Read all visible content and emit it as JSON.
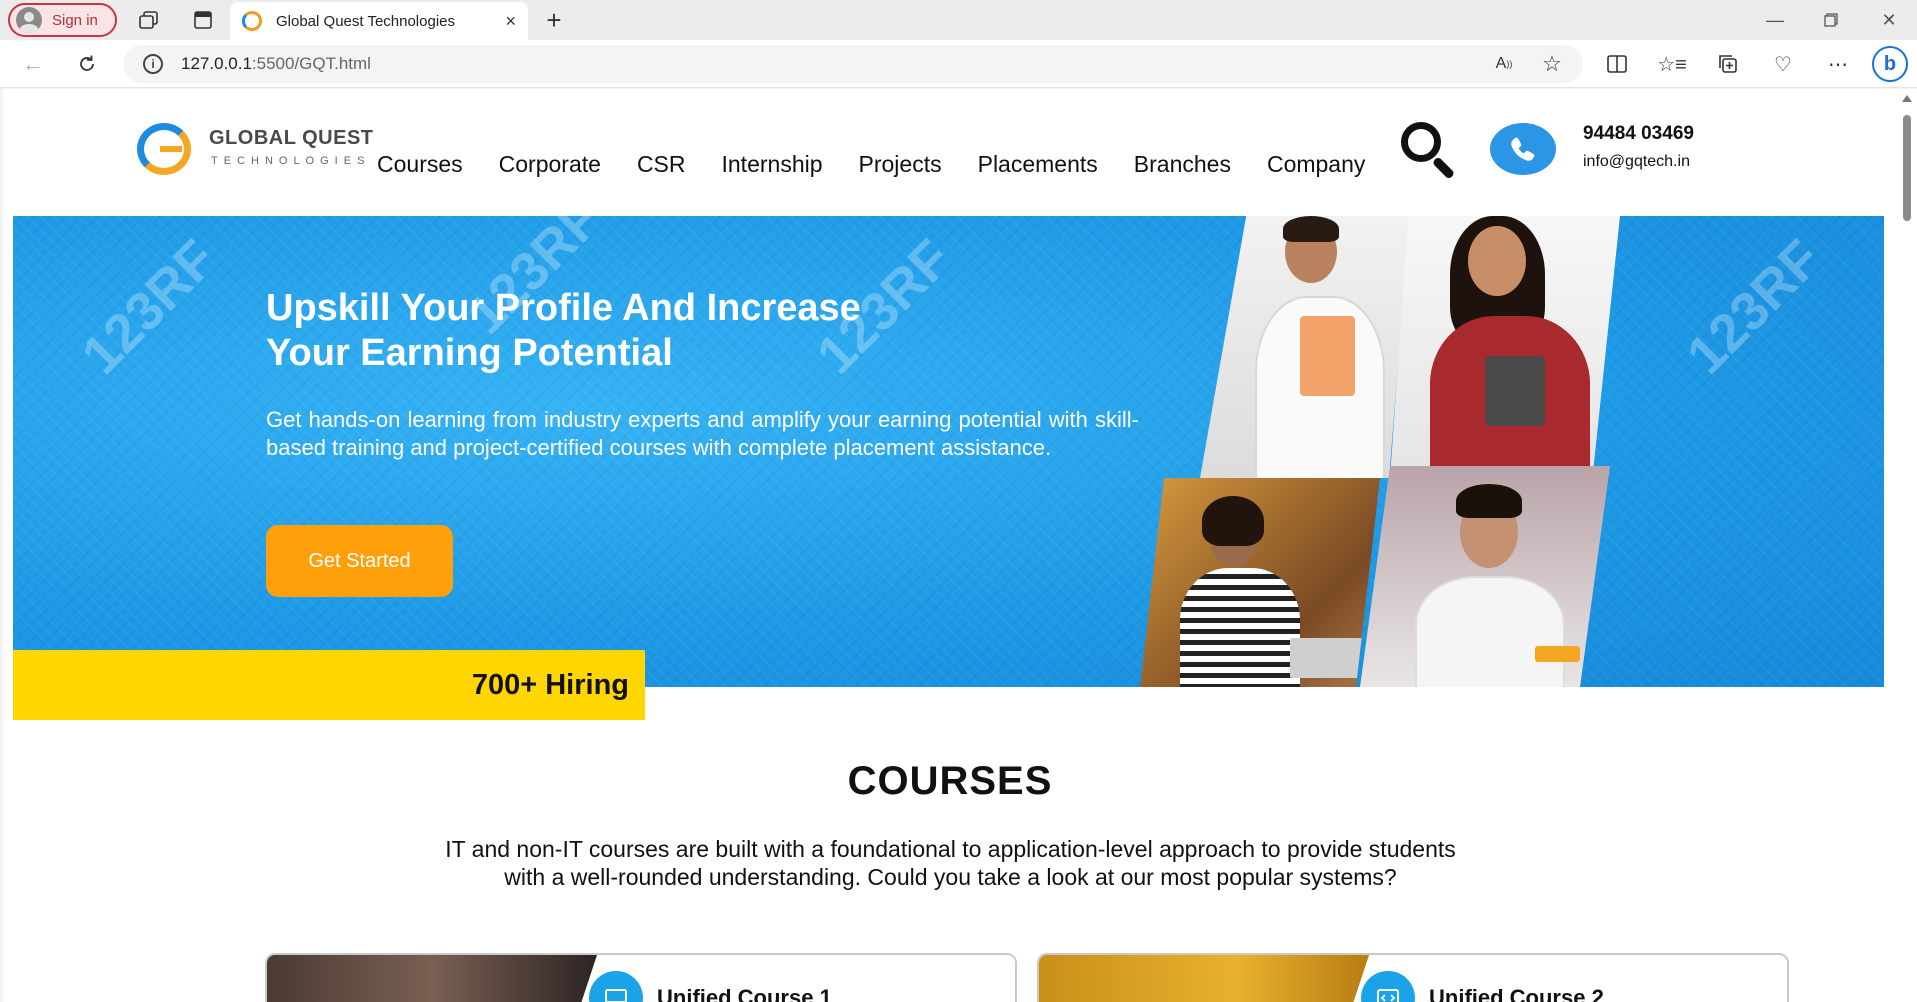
{
  "browser": {
    "signin_label": "Sign in",
    "tab_title": "Global Quest Technologies",
    "tab_close": "×",
    "new_tab": "+",
    "url_host": "127.0.0.1",
    "url_rest": ":5500/GQT.html"
  },
  "header": {
    "logo_name": "GLOBAL QUEST",
    "logo_sub": "TECHNOLOGIES",
    "nav": [
      "Courses",
      "Corporate",
      "CSR",
      "Internship",
      "Projects",
      "Placements",
      "Branches",
      "Company"
    ],
    "phone": "94484 03469",
    "email": "info@gqtech.in"
  },
  "hero": {
    "title_line1": "Upskill Your Profile And Increase",
    "title_line2": "Your Earning Potential",
    "description": "Get hands-on learning from industry experts and amplify your earning potential with skill-based training and project-certified courses with complete placement assistance.",
    "cta_label": "Get Started",
    "watermark": "123RF"
  },
  "hiring_badge": "700+ Hiring",
  "courses": {
    "title": "COURSES",
    "description": "IT and non-IT courses are built with a foundational to application-level approach to provide students with a well-rounded understanding. Could you take a look at our most popular systems?",
    "cards": [
      {
        "title": "Unified Course 1",
        "icon": "monitor-icon"
      },
      {
        "title": "Unified Course 2",
        "icon": "code-icon"
      }
    ]
  },
  "colors": {
    "hero_blue": "#1e9ae6",
    "cta_orange": "#ff9f0a",
    "hiring_yellow": "#ffd600",
    "phone_blue": "#2b96e6",
    "signin_red": "#c9363f"
  }
}
